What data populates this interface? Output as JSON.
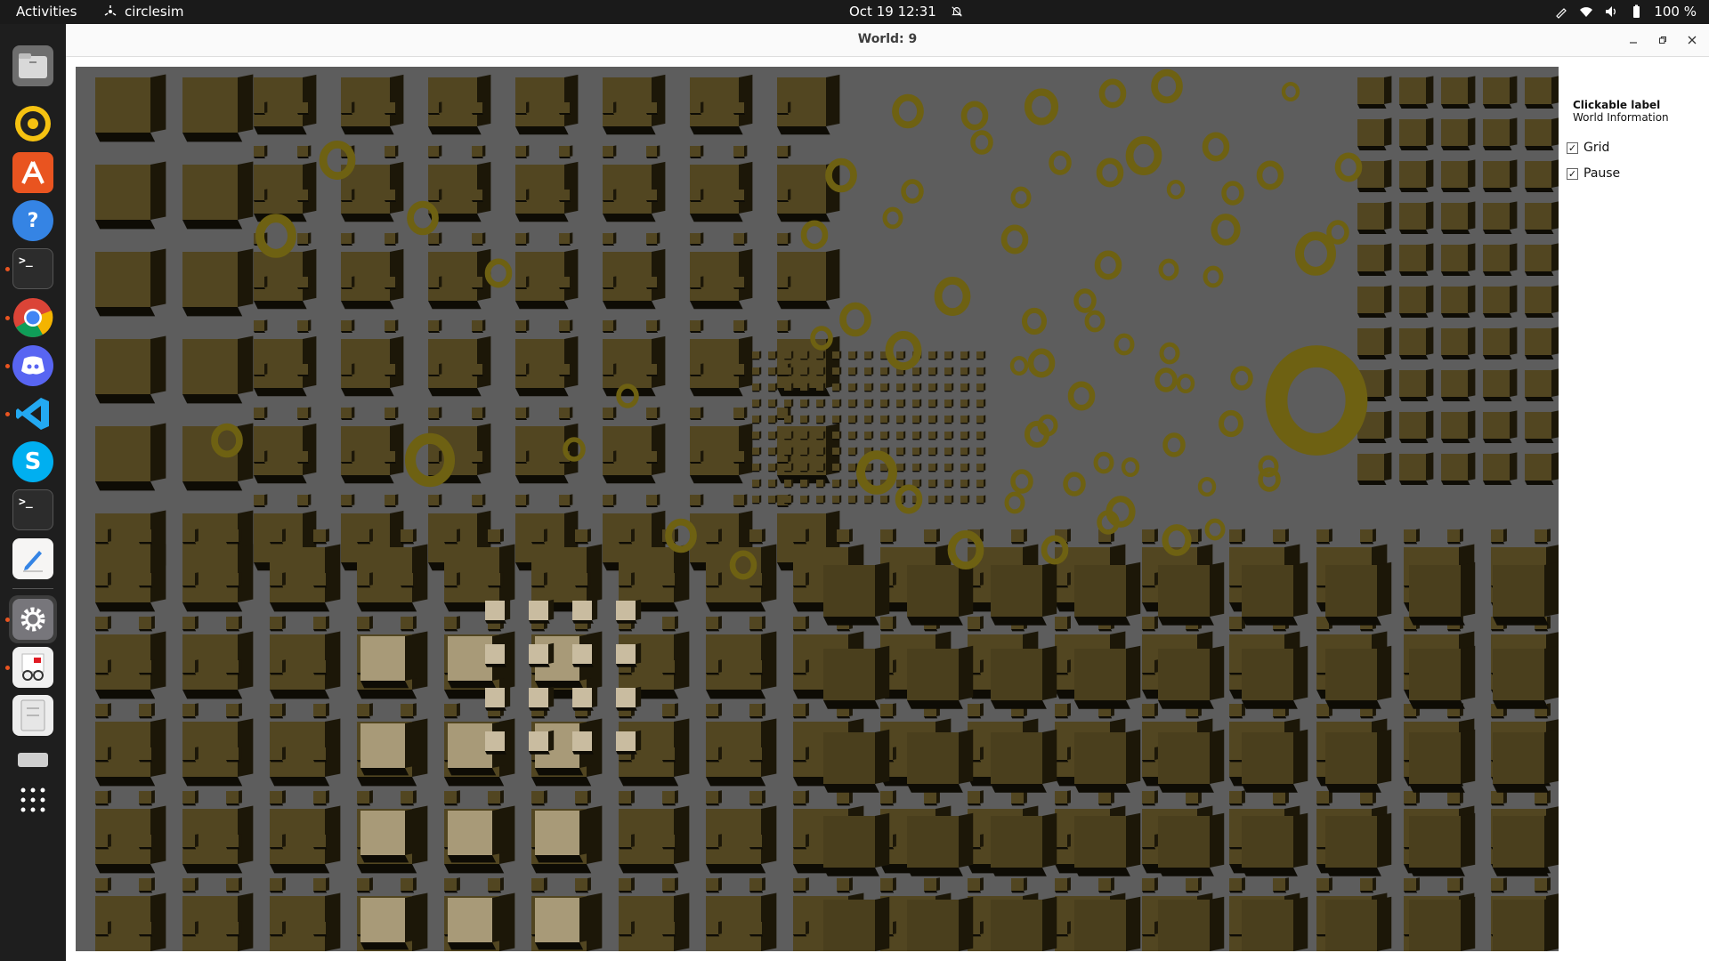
{
  "topbar": {
    "activities": "Activities",
    "app_name": "circlesim",
    "date": "Oct 19",
    "time": "12:31",
    "battery": "100 %"
  },
  "dock": {
    "items": [
      {
        "name": "files",
        "icon": "folder-icon"
      },
      {
        "name": "rhythmbox",
        "icon": "music-icon"
      },
      {
        "name": "software",
        "icon": "store-icon"
      },
      {
        "name": "help",
        "icon": "help-icon"
      },
      {
        "name": "terminal",
        "icon": "terminal-icon"
      },
      {
        "name": "chrome",
        "icon": "browser-icon"
      },
      {
        "name": "discord",
        "icon": "chat-icon"
      },
      {
        "name": "vscode",
        "icon": "code-icon"
      },
      {
        "name": "skype",
        "icon": "skype-icon"
      },
      {
        "name": "terminal-2",
        "icon": "terminal-icon"
      },
      {
        "name": "text-editor",
        "icon": "editor-icon"
      },
      {
        "name": "settings",
        "icon": "gear-icon"
      },
      {
        "name": "document-viewer",
        "icon": "viewer-icon"
      },
      {
        "name": "disks",
        "icon": "disk-icon"
      },
      {
        "name": "drive",
        "icon": "drive-icon"
      },
      {
        "name": "show-apps",
        "icon": "grid-icon"
      }
    ]
  },
  "window": {
    "title": "World: 9"
  },
  "panel": {
    "clickable_label": "Clickable label",
    "world_information": "World Information",
    "grid": {
      "label": "Grid",
      "checked": true,
      "mark": "✓"
    },
    "pause": {
      "label": "Pause",
      "checked": true,
      "mark": "✓"
    }
  },
  "colors": {
    "cube_top": "#524621",
    "cube_side": "#1c1708",
    "torus": "#6e6112",
    "background": "#5d5d5d"
  }
}
